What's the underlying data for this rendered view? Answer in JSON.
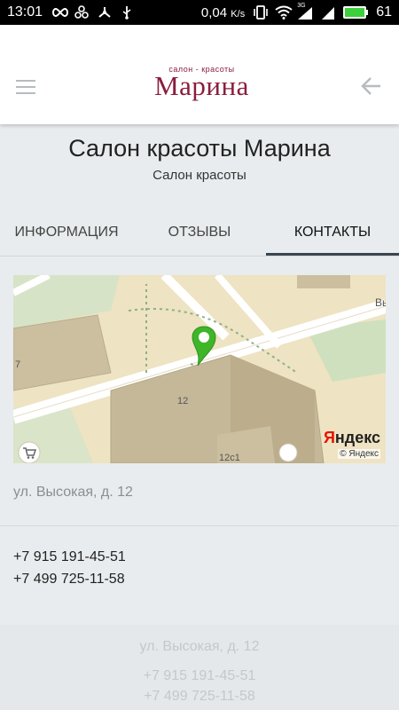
{
  "status_bar": {
    "time": "13:01",
    "speed": "0,04",
    "speed_unit": "K/s",
    "network": "3G",
    "battery": "61"
  },
  "header": {
    "logo_small": "салон - красоты",
    "logo_main": "Марина"
  },
  "page": {
    "title": "Салон красоты Марина",
    "subtitle": "Салон красоты"
  },
  "tabs": [
    {
      "label": "ИНФОРМАЦИЯ"
    },
    {
      "label": "ОТЗЫВЫ"
    },
    {
      "label": "КОНТАКТЫ"
    }
  ],
  "map": {
    "street_label": "Вы",
    "building_labels": [
      "7",
      "12",
      "12с1"
    ],
    "provider_logo": "Яндекс",
    "copyright": "© Яндекс"
  },
  "contacts": {
    "address": "ул. Высокая, д. 12",
    "phones": [
      "+7 915 191-45-51",
      "+7 499 725-11-58"
    ]
  },
  "footer": {
    "address": "ул. Высокая, д. 12",
    "phones": [
      "+7 915 191-45-51",
      "+7 499 725-11-58"
    ]
  },
  "colors": {
    "brand": "#8a1d3d",
    "pin": "#3fb52a",
    "battery": "#3cd13c"
  }
}
